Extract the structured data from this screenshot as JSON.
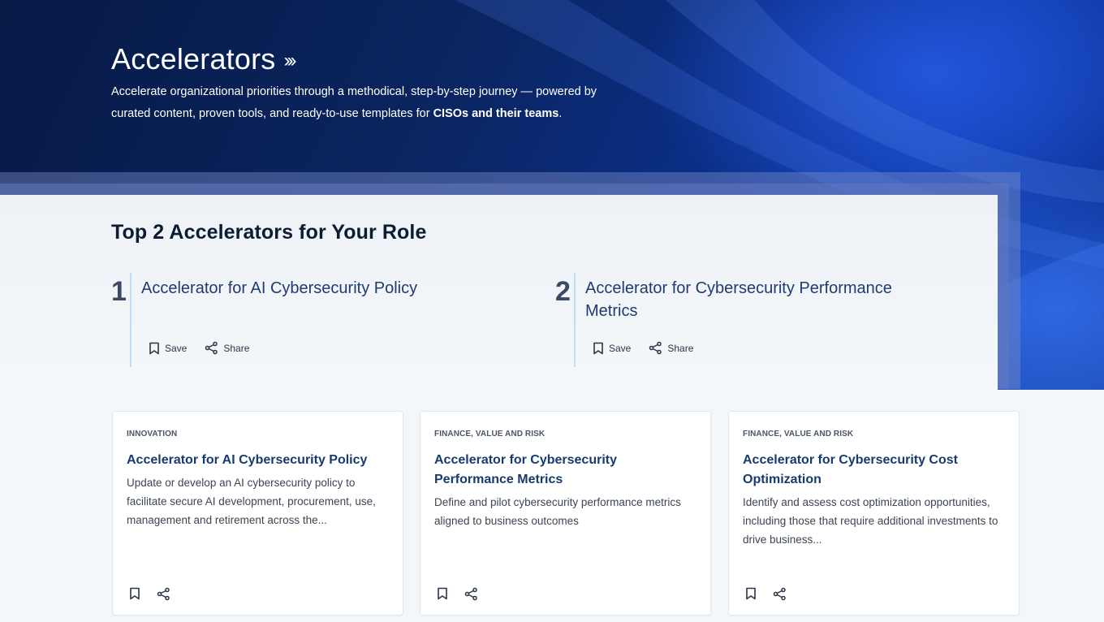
{
  "hero": {
    "title": "Accelerators",
    "title_chevrons": "›››",
    "description_part1": "Accelerate organizational priorities through a methodical, step-by-step journey — powered by curated content, proven tools, and ready-to-use templates for ",
    "description_bold": "CISOs and their teams",
    "description_end": "."
  },
  "top_section": {
    "title": "Top 2 Accelerators for Your Role",
    "items": [
      {
        "number": "1",
        "title": "Accelerator for AI Cybersecurity Policy",
        "save_label": "Save",
        "share_label": "Share"
      },
      {
        "number": "2",
        "title": "Accelerator for Cybersecurity Performance Metrics",
        "save_label": "Save",
        "share_label": "Share"
      }
    ]
  },
  "cards": [
    {
      "category": "INNOVATION",
      "title": "Accelerator for AI Cybersecurity Policy",
      "description": "Update or develop an AI cybersecurity policy to facilitate secure AI development, procurement, use, management and retirement across the..."
    },
    {
      "category": "FINANCE, VALUE AND RISK",
      "title": "Accelerator for Cybersecurity Performance Metrics",
      "description": "Define and pilot cybersecurity performance metrics aligned to business outcomes"
    },
    {
      "category": "FINANCE, VALUE AND RISK",
      "title": "Accelerator for Cybersecurity Cost Optimization",
      "description": "Identify and assess cost optimization opportunities, including those that require additional investments to drive business..."
    }
  ],
  "icons": {
    "save": "bookmark-icon",
    "share": "share-icon"
  }
}
